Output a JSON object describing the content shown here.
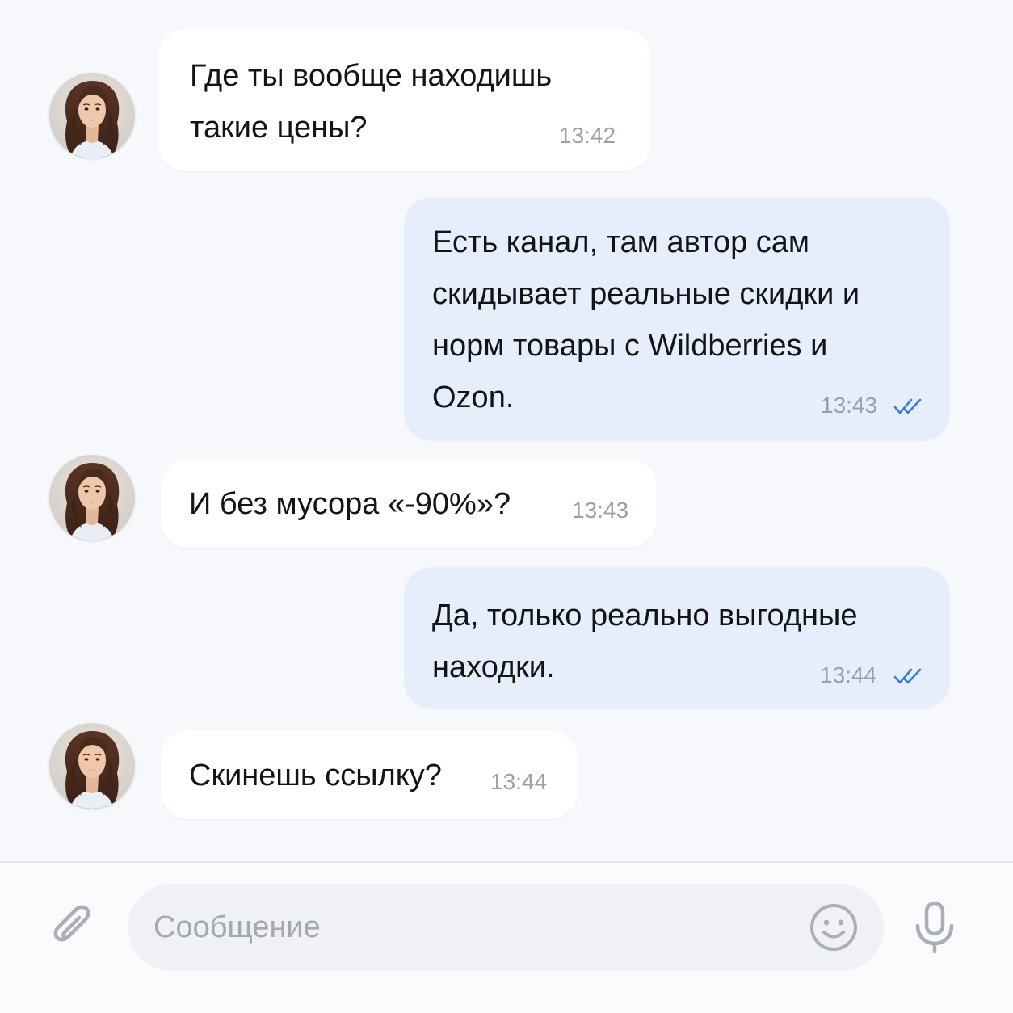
{
  "messages": [
    {
      "direction": "incoming",
      "lines": [
        "Где ты вообще находишь",
        "такие цены?"
      ],
      "time": "13:42",
      "avatar_icon": "woman-avatar"
    },
    {
      "direction": "outgoing",
      "lines": [
        "Есть канал, там автор сам",
        "скидывает реальные скидки и",
        "норм товары с Wildberries и",
        "Ozon."
      ],
      "time": "13:43",
      "status_icon": "double-check-icon",
      "status": "read"
    },
    {
      "direction": "incoming",
      "lines": [
        "И без мусора «-90%»?"
      ],
      "time": "13:43",
      "avatar_icon": "woman-avatar"
    },
    {
      "direction": "outgoing",
      "lines": [
        "Да, только реально выгодные",
        "находки."
      ],
      "time": "13:44",
      "status_icon": "double-check-icon",
      "status": "read"
    },
    {
      "direction": "incoming",
      "lines": [
        "Скинешь ссылку?"
      ],
      "time": "13:44",
      "avatar_icon": "woman-avatar"
    }
  ],
  "composer": {
    "placeholder": "Сообщение",
    "value": "",
    "attach_icon": "paperclip-icon",
    "emoji_icon": "smiley-icon",
    "voice_icon": "microphone-icon"
  },
  "colors": {
    "background": "#f7f8fc",
    "incoming_bubble": "#ffffff",
    "outgoing_bubble": "#e6eefb",
    "timestamp": "#9aa0aa",
    "read_check": "#3d7bd9",
    "input_fill": "#eff1f5",
    "icon_gray": "#a9aeb8"
  }
}
